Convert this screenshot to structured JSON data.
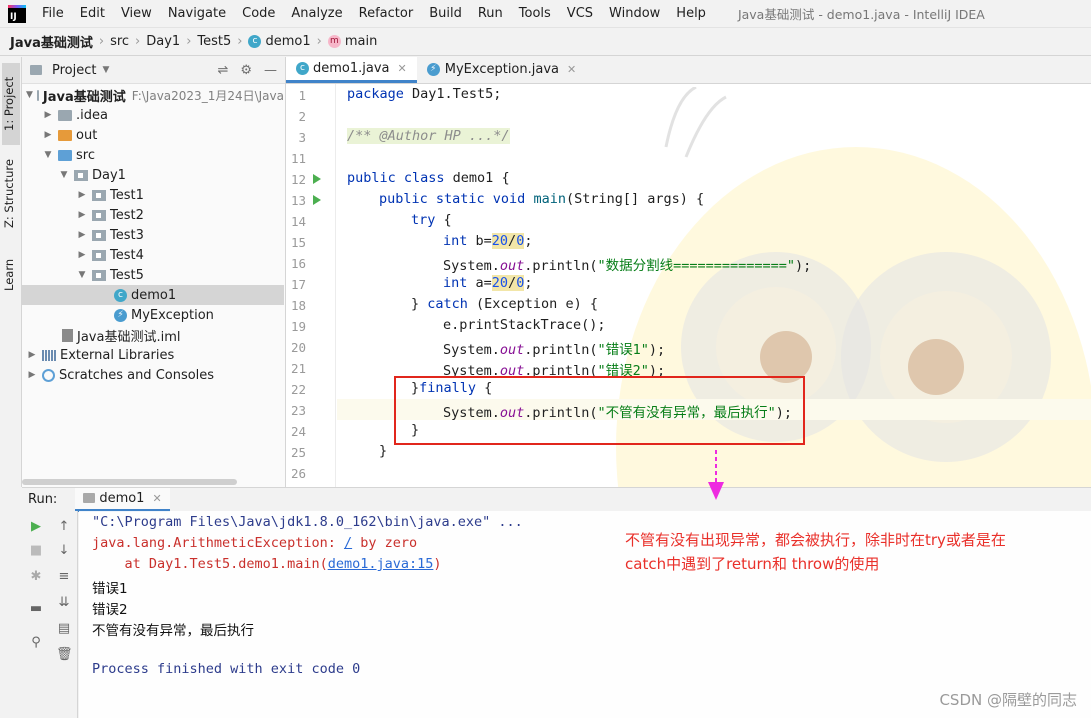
{
  "menubar": {
    "logo": "IJ",
    "items": [
      "File",
      "Edit",
      "View",
      "Navigate",
      "Code",
      "Analyze",
      "Refactor",
      "Build",
      "Run",
      "Tools",
      "VCS",
      "Window",
      "Help"
    ],
    "window_title": "Java基础测试 - demo1.java - IntelliJ IDEA"
  },
  "navbar": {
    "crumbs": [
      "Java基础测试",
      "src",
      "Day1",
      "Test5",
      "demo1",
      "main"
    ]
  },
  "left_strip": {
    "project": "1: Project",
    "structure": "Z: Structure",
    "learn": "Learn"
  },
  "project": {
    "title": "Project",
    "tree": [
      {
        "label": "Java基础测试",
        "path": "F:\\Java2023_1月24日\\Java"
      },
      {
        "label": ".idea"
      },
      {
        "label": "out"
      },
      {
        "label": "src"
      },
      {
        "label": "Day1"
      },
      {
        "label": "Test1"
      },
      {
        "label": "Test2"
      },
      {
        "label": "Test3"
      },
      {
        "label": "Test4"
      },
      {
        "label": "Test5"
      },
      {
        "label": "demo1"
      },
      {
        "label": "MyException"
      },
      {
        "label": "Java基础测试.iml"
      },
      {
        "label": "External Libraries"
      },
      {
        "label": "Scratches and Consoles"
      }
    ]
  },
  "editor": {
    "tabs": [
      {
        "label": "demo1.java",
        "active": true
      },
      {
        "label": "MyException.java",
        "active": false
      }
    ],
    "line_numbers": [
      "1",
      "2",
      "3",
      "11",
      "12",
      "13",
      "14",
      "15",
      "16",
      "17",
      "18",
      "19",
      "20",
      "21",
      "22",
      "23",
      "24",
      "25",
      "26"
    ],
    "code": {
      "l1_kw": "package",
      "l1_rest": " Day1.Test5;",
      "l3": "/** @Author HP ...*/",
      "l12_kw": "public class",
      "l12_rest": " demo1 {",
      "l13_kw": "public static void",
      "l13_name": " main",
      "l13_rest": "(String[] args) {",
      "l14_kw": "try",
      "l14_rest": " {",
      "l15_kw": "int",
      "l15_a": " b=",
      "l15_n1": "20",
      "l15_b": "/",
      "l15_n2": "0",
      "l15_c": ";",
      "l16_a": "System.",
      "l16_out": "out",
      "l16_b": ".println(",
      "l16_str": "\"数据分割线==============\"",
      "l16_c": ");",
      "l17_kw": "int",
      "l17_a": " a=",
      "l17_n1": "20",
      "l17_b": "/",
      "l17_n2": "0",
      "l17_c": ";",
      "l18_a": "} ",
      "l18_kw": "catch",
      "l18_rest": " (Exception e) {",
      "l19": "e.printStackTrace();",
      "l20_a": "System.",
      "l20_out": "out",
      "l20_b": ".println(",
      "l20_str": "\"错误1\"",
      "l20_c": ");",
      "l21_a": "System.",
      "l21_out": "out",
      "l21_b": ".println(",
      "l21_str": "\"错误2\"",
      "l21_c": ");",
      "l22_a": "}",
      "l22_kw": "finally",
      "l22_rest": " {",
      "l23_a": "System.",
      "l23_out": "out",
      "l23_b": ".println(",
      "l23_str": "\"不管有没有异常，最后执行\"",
      "l23_c": ");",
      "l24": "}",
      "l25": "}"
    }
  },
  "run": {
    "label": "Run:",
    "tab": "demo1",
    "console": {
      "cmd": "\"C:\\Program Files\\Java\\jdk1.8.0_162\\bin\\java.exe\" ...",
      "exc_a": "java.lang.ArithmeticException: ",
      "exc_link": "/",
      "exc_b": " by zero",
      "at_a": "    at Day1.Test5.demo1.main(",
      "at_link": "demo1.java:15",
      "at_b": ")",
      "out1": "错误1",
      "out2": "错误2",
      "out3": "不管有没有异常，最后执行",
      "process": "Process finished with exit code 0"
    }
  },
  "annotation": {
    "line1": "不管有没有出现异常，都会被执行，除非时在try或者是在",
    "line2": "catch中遇到了return和 throw的使用"
  },
  "watermark": "CSDN @隔壁的同志",
  "colors": {
    "annotation_red": "#e9302a",
    "box_red": "#e1261c",
    "arrow_pink": "#ee2be0",
    "keyword": "#0033b3",
    "string": "#067d17"
  }
}
